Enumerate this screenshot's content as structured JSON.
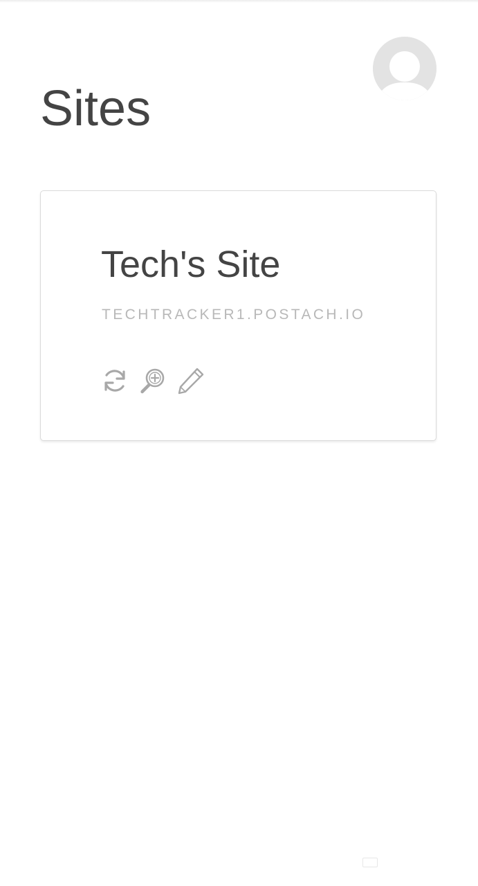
{
  "header": {
    "title": "Sites",
    "avatar_icon": "user-avatar-icon"
  },
  "sites": [
    {
      "name": "Tech's Site",
      "url": "TECHTRACKER1.POSTACH.IO",
      "actions": [
        {
          "icon": "refresh-icon"
        },
        {
          "icon": "zoom-in-icon"
        },
        {
          "icon": "pencil-icon"
        }
      ]
    }
  ],
  "colors": {
    "title_text": "#444444",
    "url_text": "#b8b8b8",
    "icon_stroke": "#a8a8a8",
    "avatar_bg": "#e3e3e3",
    "card_border": "#dadada"
  }
}
